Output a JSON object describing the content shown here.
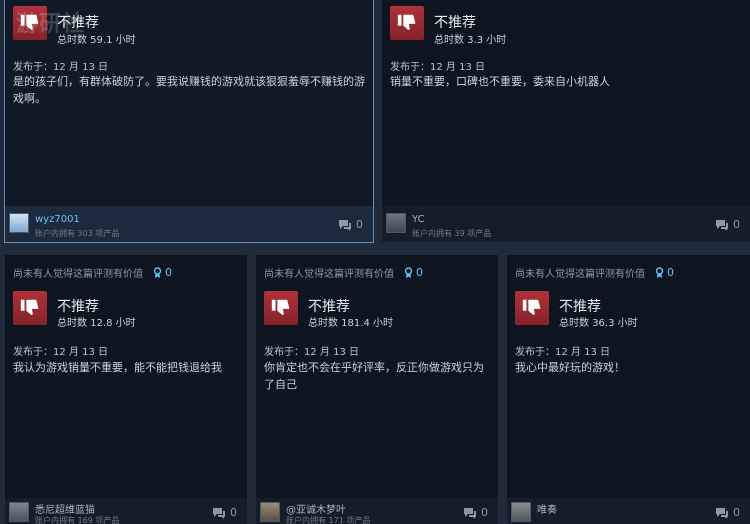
{
  "watermark": "游研社",
  "reviews": [
    {
      "verdict": "不推荐",
      "hours": "总时数 59.1 小时",
      "posted": "发布于：12 月 13 日",
      "text": "是的孩子们，有群体破防了。要我说赚钱的游戏就该狠狠羞辱不赚钱的游戏啊。",
      "user": "wyz7001",
      "products": "账户内拥有 303 项产品",
      "comments": "0"
    },
    {
      "verdict": "不推荐",
      "hours": "总时数 3.3 小时",
      "posted": "发布于：12 月 13 日",
      "text": "销量不重要，口碑也不重要，委来自小机器人",
      "user": "YC",
      "products": "账户内拥有 39 项产品",
      "comments": "0"
    },
    {
      "helpful": "尚未有人觉得这篇评测有价值",
      "awards": "0",
      "verdict": "不推荐",
      "hours": "总时数 12.8 小时",
      "posted": "发布于：12 月 13 日",
      "text": "我认为游戏销量不重要，能不能把钱退给我",
      "user": "悉尼超维蓝猫",
      "products": "账户内拥有 169 项产品",
      "comments": "0"
    },
    {
      "helpful": "尚未有人觉得这篇评测有价值",
      "awards": "0",
      "verdict": "不推荐",
      "hours": "总时数 181.4 小时",
      "posted": "发布于：12 月 13 日",
      "text": "你肯定也不会在乎好评率，反正你做游戏只为了自己",
      "user": "@亚诚木梦叶",
      "products": "账户内拥有 171 项产品",
      "comments": "0"
    },
    {
      "helpful": "尚未有人觉得这篇评测有价值",
      "awards": "0",
      "verdict": "不推荐",
      "hours": "总时数 36.3 小时",
      "posted": "发布于：12 月 13 日",
      "text": "我心中最好玩的游戏！",
      "user": "唯奏",
      "products": "",
      "comments": "0"
    }
  ]
}
